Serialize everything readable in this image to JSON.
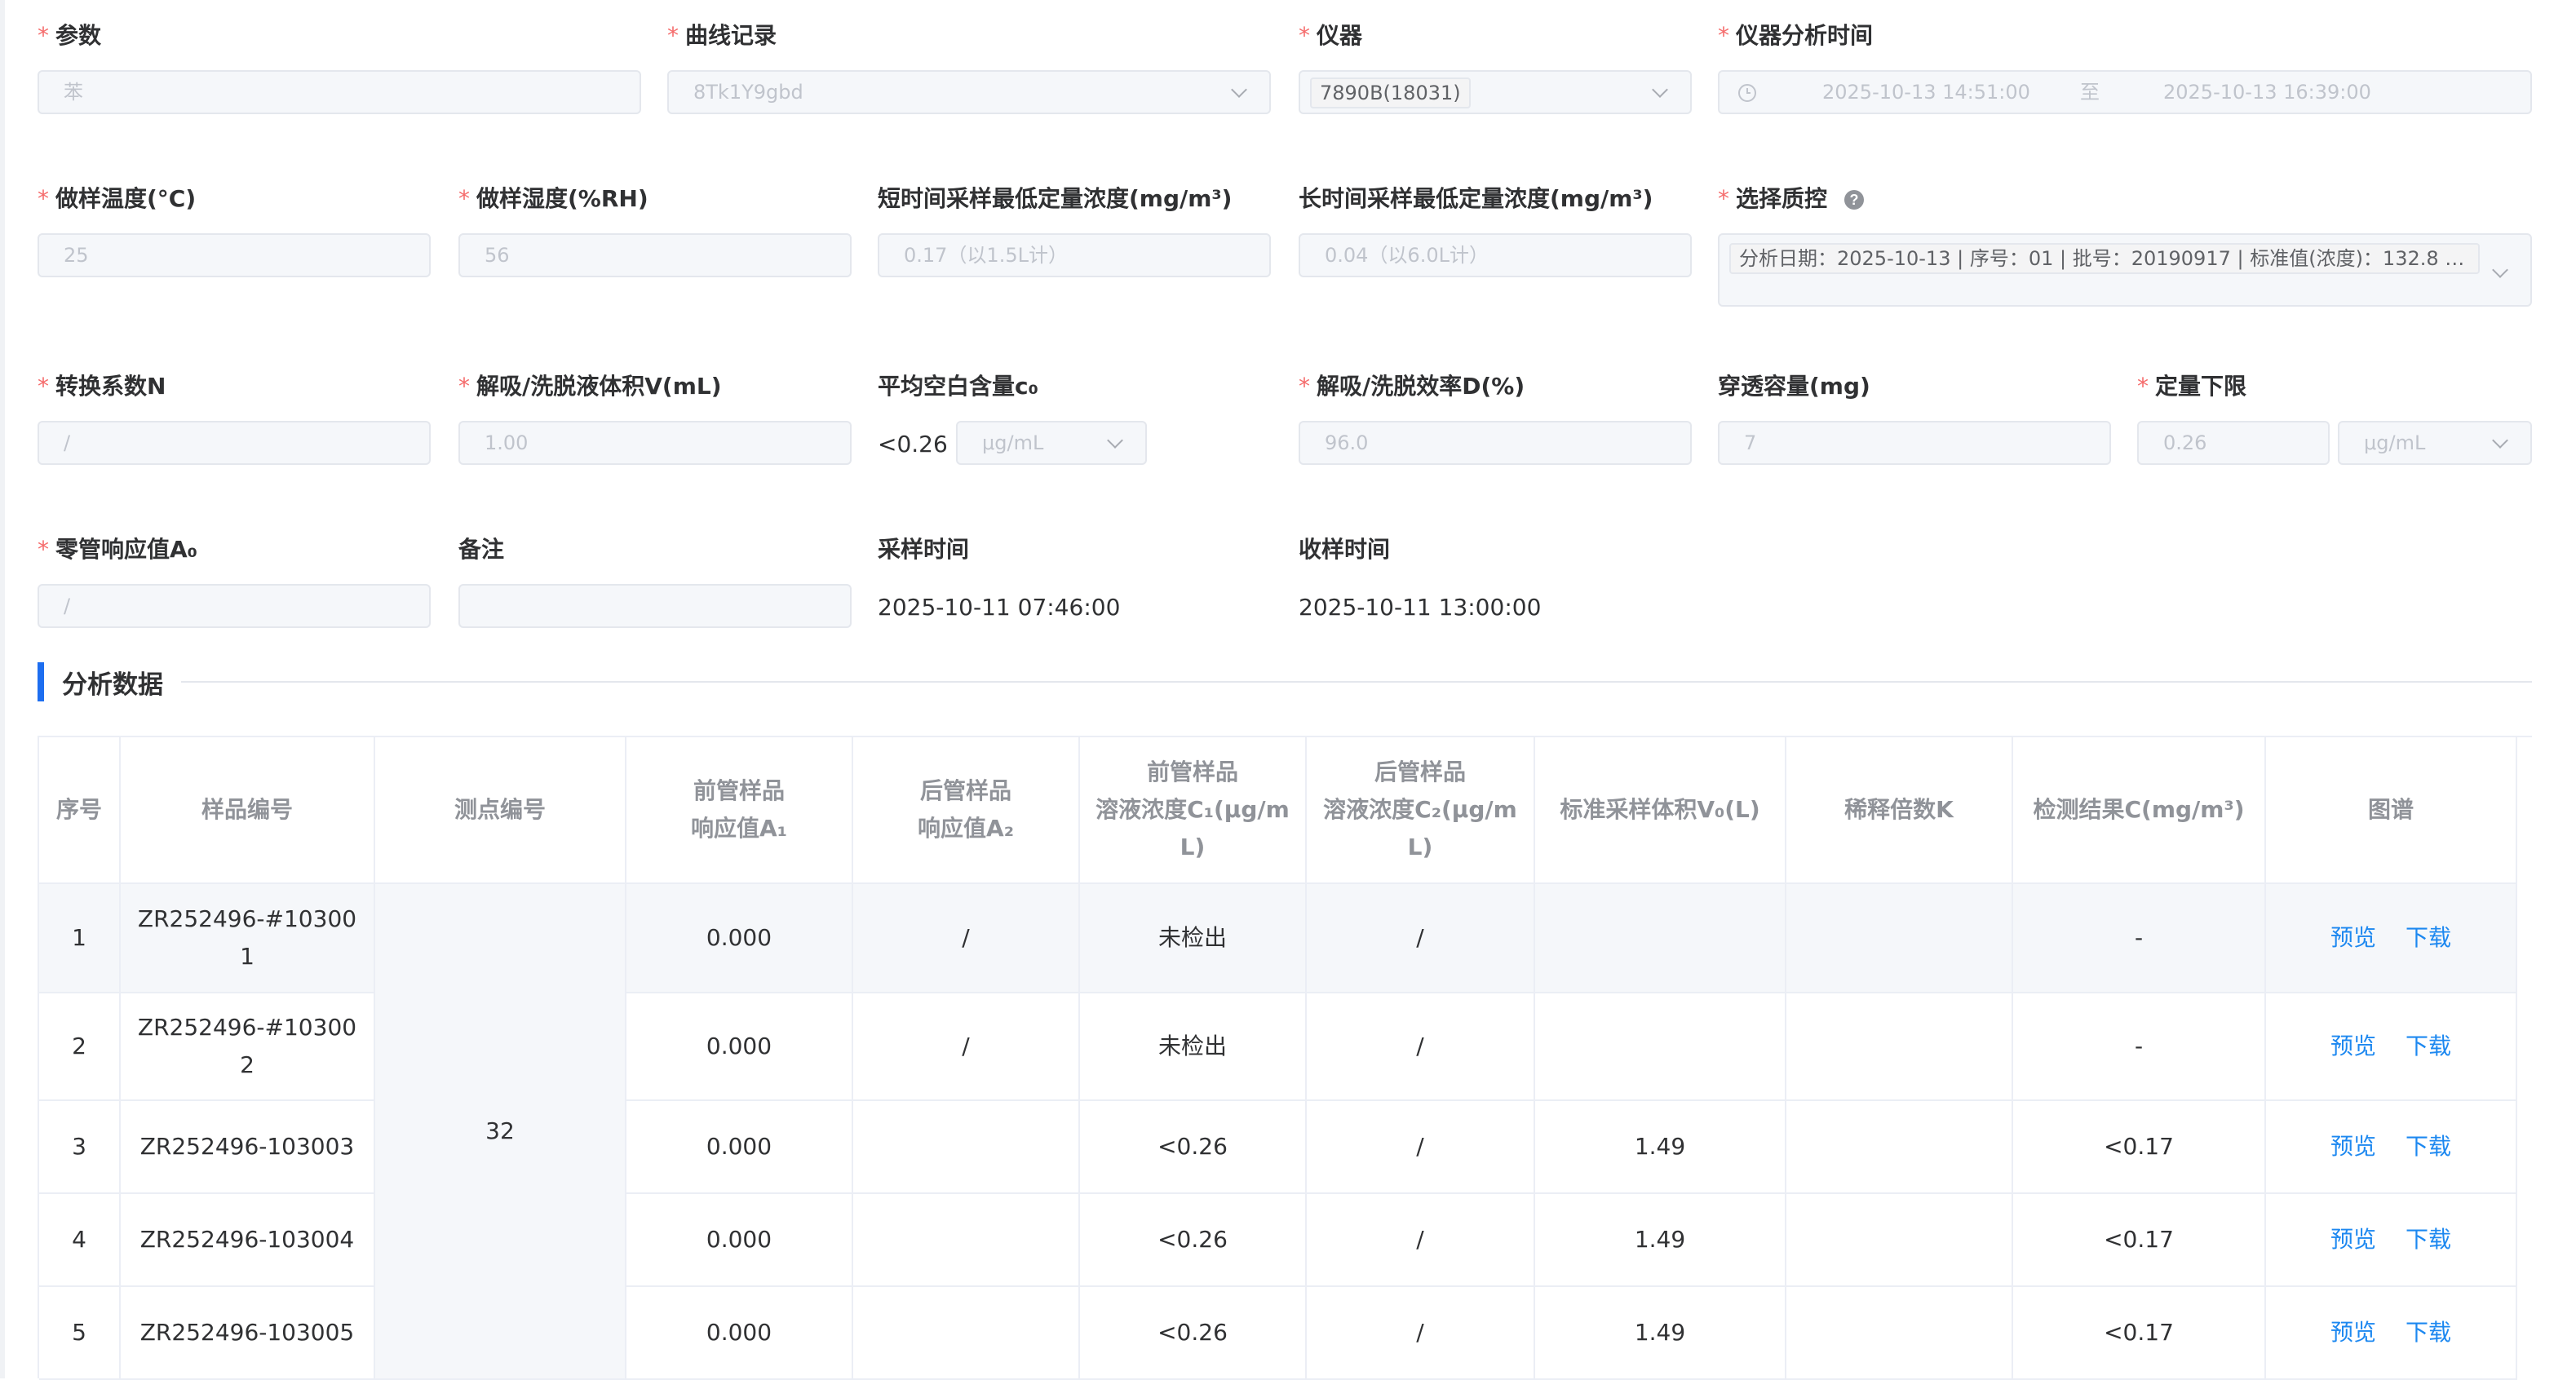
{
  "form": {
    "param": {
      "label": "参数",
      "value": "苯"
    },
    "curve": {
      "label": "曲线记录",
      "value": "8Tk1Y9gbd"
    },
    "instrument": {
      "label": "仪器",
      "value": "7890B(18031)"
    },
    "analysis_time": {
      "label": "仪器分析时间",
      "start": "2025-10-13 14:51:00",
      "sep": "至",
      "end": "2025-10-13 16:39:00"
    },
    "temp": {
      "label": "做样温度(°C)",
      "value": "25"
    },
    "humidity": {
      "label": "做样湿度(%RH)",
      "value": "56"
    },
    "short_min": {
      "label": "短时间采样最低定量浓度(mg/m³)",
      "value": "0.17（以1.5L计）"
    },
    "long_min": {
      "label": "长时间采样最低定量浓度(mg/m³)",
      "value": "0.04（以6.0L计）"
    },
    "qc": {
      "label": "选择质控",
      "value": "分析日期：2025-10-13 | 序号：01 | 批号：20190917 | 标准值(浓度)：132.8 | ..."
    },
    "conv_n": {
      "label": "转换系数N",
      "value": "/"
    },
    "volume_v": {
      "label": "解吸/洗脱液体积V(mL)",
      "value": "1.00"
    },
    "blank_c0": {
      "label": "平均空白含量c₀",
      "prefix": "<0.26",
      "unit": "μg/mL"
    },
    "efficiency_d": {
      "label": "解吸/洗脱效率D(%)",
      "value": "96.0"
    },
    "breakthrough": {
      "label": "穿透容量(mg)",
      "value": "7"
    },
    "lod": {
      "label": "定量下限",
      "value": "0.26",
      "unit": "μg/mL"
    },
    "zero_a0": {
      "label": "零管响应值A₀",
      "value": "/"
    },
    "remark": {
      "label": "备注",
      "value": ""
    },
    "sample_time": {
      "label": "采样时间",
      "value": "2025-10-11 07:46:00"
    },
    "receive_time": {
      "label": "收样时间",
      "value": "2025-10-11 13:00:00"
    }
  },
  "section": {
    "title": "分析数据"
  },
  "table": {
    "headers": [
      "序号",
      "样品编号",
      "测点编号",
      "前管样品\n响应值A₁",
      "后管样品\n响应值A₂",
      "前管样品\n溶液浓度C₁(μg/m\nL)",
      "后管样品\n溶液浓度C₂(μg/m\nL)",
      "标准采样体积V₀(L)",
      "稀释倍数K",
      "检测结果C(mg/m³)",
      "图谱"
    ],
    "point": "32",
    "rows": [
      {
        "no": "1",
        "sample": "ZR252496-#10300\n1",
        "a1": "0.000",
        "a2": "/",
        "c1": "未检出",
        "c2": "/",
        "v0": "",
        "k": "",
        "result": "-",
        "preview": "预览",
        "download": "下载"
      },
      {
        "no": "2",
        "sample": "ZR252496-#10300\n2",
        "a1": "0.000",
        "a2": "/",
        "c1": "未检出",
        "c2": "/",
        "v0": "",
        "k": "",
        "result": "-",
        "preview": "预览",
        "download": "下载"
      },
      {
        "no": "3",
        "sample": "ZR252496-103003",
        "a1": "0.000",
        "a2": "",
        "c1": "<0.26",
        "c2": "/",
        "v0": "1.49",
        "k": "",
        "result": "<0.17",
        "preview": "预览",
        "download": "下载"
      },
      {
        "no": "4",
        "sample": "ZR252496-103004",
        "a1": "0.000",
        "a2": "",
        "c1": "<0.26",
        "c2": "/",
        "v0": "1.49",
        "k": "",
        "result": "<0.17",
        "preview": "预览",
        "download": "下载"
      },
      {
        "no": "5",
        "sample": "ZR252496-103005",
        "a1": "0.000",
        "a2": "",
        "c1": "<0.26",
        "c2": "/",
        "v0": "1.49",
        "k": "",
        "result": "<0.17",
        "preview": "预览",
        "download": "下载"
      }
    ]
  },
  "colors": {
    "required": "#f56c6c",
    "accent": "#1d6ef0",
    "link": "#1d88f0",
    "border": "#ebeef5"
  }
}
